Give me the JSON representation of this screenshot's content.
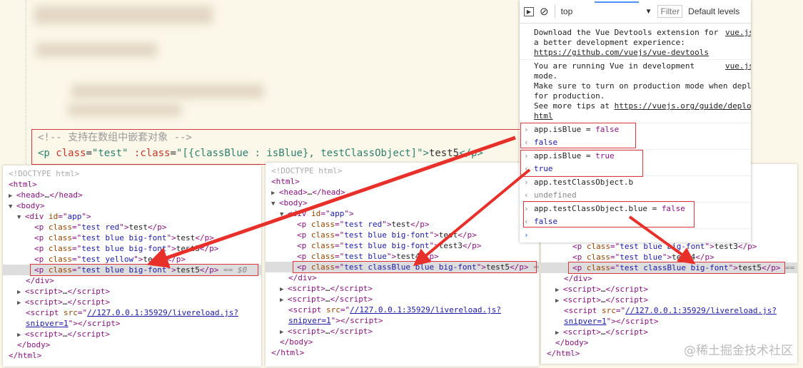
{
  "editor": {
    "comment": "<!-- 支持在数组中嵌套对象 -->",
    "line": [
      [
        "t",
        "<p "
      ],
      [
        "a",
        "class"
      ],
      [
        "x",
        "="
      ],
      [
        "v",
        "\"test\" "
      ],
      [
        "a",
        ":class"
      ],
      [
        "x",
        "="
      ],
      [
        "v",
        "\"[{classBlue : isBlue}, testClassObject]\""
      ],
      [
        "t",
        ">"
      ],
      [
        "x",
        "test5"
      ],
      [
        "t",
        "</p>"
      ]
    ]
  },
  "panels": [
    {
      "selected": 9,
      "lines": [
        [
          0,
          [
            [
              "cm",
              "<!DOCTYPE html>"
            ]
          ]
        ],
        [
          0,
          [
            [
              "tg",
              "<html>"
            ]
          ]
        ],
        [
          0,
          [
            [
              "ar",
              "▶ "
            ],
            [
              "tg",
              "<head>"
            ],
            [
              "tx",
              "…"
            ],
            [
              "tg",
              "</head>"
            ]
          ]
        ],
        [
          0,
          [
            [
              "ar",
              "▼ "
            ],
            [
              "tg",
              "<body>"
            ]
          ]
        ],
        [
          1,
          [
            [
              "ar",
              "▼ "
            ],
            [
              "tg",
              "<div "
            ],
            [
              "an",
              "id"
            ],
            [
              "tg",
              "=\""
            ],
            [
              "av",
              "app"
            ],
            [
              "tg",
              "\">"
            ]
          ]
        ],
        [
          3,
          [
            [
              "tg",
              "<p "
            ],
            [
              "an",
              "class"
            ],
            [
              "tg",
              "=\""
            ],
            [
              "av",
              "test red"
            ],
            [
              "tg",
              "\">"
            ],
            [
              "tx",
              "test"
            ],
            [
              "tg",
              "</p>"
            ]
          ]
        ],
        [
          3,
          [
            [
              "tg",
              "<p "
            ],
            [
              "an",
              "class"
            ],
            [
              "tg",
              "=\""
            ],
            [
              "av",
              "test blue big-font"
            ],
            [
              "tg",
              "\">"
            ],
            [
              "tx",
              "test"
            ],
            [
              "tg",
              "</p>"
            ]
          ]
        ],
        [
          3,
          [
            [
              "tg",
              "<p "
            ],
            [
              "an",
              "class"
            ],
            [
              "tg",
              "=\""
            ],
            [
              "av",
              "test blue big-font"
            ],
            [
              "tg",
              "\">"
            ],
            [
              "tx",
              "test3"
            ],
            [
              "tg",
              "</p>"
            ]
          ]
        ],
        [
          3,
          [
            [
              "tg",
              "<p "
            ],
            [
              "an",
              "class"
            ],
            [
              "tg",
              "=\""
            ],
            [
              "av",
              "test yellow"
            ],
            [
              "tg",
              "\">"
            ],
            [
              "tx",
              "test4"
            ],
            [
              "tg",
              "</p>"
            ]
          ]
        ],
        [
          3,
          [
            [
              "tg",
              "<p "
            ],
            [
              "an",
              "class"
            ],
            [
              "tg",
              "=\""
            ],
            [
              "av",
              "test blue big-font"
            ],
            [
              "tg",
              "\">"
            ],
            [
              "tx",
              "test5"
            ],
            [
              "tg",
              "</p>"
            ],
            [
              "dl",
              " == $0"
            ]
          ]
        ],
        [
          2,
          [
            [
              "tg",
              "</div>"
            ]
          ]
        ],
        [
          1,
          [
            [
              "ar",
              "▶ "
            ],
            [
              "tg",
              "<script>"
            ],
            [
              "tx",
              "…"
            ],
            [
              "tg",
              "</script>"
            ]
          ]
        ],
        [
          1,
          [
            [
              "ar",
              "▶ "
            ],
            [
              "tg",
              "<script>"
            ],
            [
              "tx",
              "…"
            ],
            [
              "tg",
              "</script>"
            ]
          ]
        ],
        [
          2,
          [
            [
              "tg",
              "<script "
            ],
            [
              "an",
              "src"
            ],
            [
              "tg",
              "=\""
            ],
            [
              "lk",
              "//127.0.0.1:35929/livereload.js?"
            ]
          ]
        ],
        [
          2,
          [
            [
              "lk",
              "snipver=1"
            ],
            [
              "tg",
              "\"></script>"
            ]
          ]
        ],
        [
          1,
          [
            [
              "ar",
              "▶ "
            ],
            [
              "tg",
              "<script>"
            ],
            [
              "tx",
              "…"
            ],
            [
              "tg",
              "</script>"
            ]
          ]
        ],
        [
          1,
          [
            [
              "tg",
              "</body>"
            ]
          ]
        ],
        [
          0,
          [
            [
              "tg",
              "</html>"
            ]
          ]
        ]
      ]
    },
    {
      "selected": 9,
      "lines": [
        [
          0,
          [
            [
              "cm",
              "<!DOCTYPE html>"
            ]
          ]
        ],
        [
          0,
          [
            [
              "tg",
              "<html>"
            ]
          ]
        ],
        [
          0,
          [
            [
              "ar",
              "▶ "
            ],
            [
              "tg",
              "<head>"
            ],
            [
              "tx",
              "…"
            ],
            [
              "tg",
              "</head>"
            ]
          ]
        ],
        [
          0,
          [
            [
              "ar",
              "▼ "
            ],
            [
              "tg",
              "<body>"
            ]
          ]
        ],
        [
          1,
          [
            [
              "ar",
              "▼ "
            ],
            [
              "tg",
              "<div "
            ],
            [
              "an",
              "id"
            ],
            [
              "tg",
              "=\""
            ],
            [
              "av",
              "app"
            ],
            [
              "tg",
              "\">"
            ]
          ]
        ],
        [
          3,
          [
            [
              "tg",
              "<p "
            ],
            [
              "an",
              "class"
            ],
            [
              "tg",
              "=\""
            ],
            [
              "av",
              "test red"
            ],
            [
              "tg",
              "\">"
            ],
            [
              "tx",
              "test"
            ],
            [
              "tg",
              "</p>"
            ]
          ]
        ],
        [
          3,
          [
            [
              "tg",
              "<p "
            ],
            [
              "an",
              "class"
            ],
            [
              "tg",
              "=\""
            ],
            [
              "av",
              "test blue big-font"
            ],
            [
              "tg",
              "\">"
            ],
            [
              "tx",
              "test"
            ],
            [
              "tg",
              "</p>"
            ]
          ]
        ],
        [
          3,
          [
            [
              "tg",
              "<p "
            ],
            [
              "an",
              "class"
            ],
            [
              "tg",
              "=\""
            ],
            [
              "av",
              "test blue big-font"
            ],
            [
              "tg",
              "\">"
            ],
            [
              "tx",
              "test3"
            ],
            [
              "tg",
              "</p>"
            ]
          ]
        ],
        [
          3,
          [
            [
              "tg",
              "<p "
            ],
            [
              "an",
              "class"
            ],
            [
              "tg",
              "=\""
            ],
            [
              "av",
              "test blue"
            ],
            [
              "tg",
              "\">"
            ],
            [
              "tx",
              "test4"
            ],
            [
              "tg",
              "</p>"
            ]
          ]
        ],
        [
          3,
          [
            [
              "tg",
              "<p "
            ],
            [
              "an",
              "class"
            ],
            [
              "tg",
              "=\""
            ],
            [
              "av",
              "test classBlue blue big-font"
            ],
            [
              "tg",
              "\">"
            ],
            [
              "tx",
              "test5"
            ],
            [
              "tg",
              "</p>"
            ],
            [
              "dl",
              " =="
            ]
          ]
        ],
        [
          2,
          [
            [
              "tg",
              "</div>"
            ]
          ]
        ],
        [
          1,
          [
            [
              "ar",
              "▶ "
            ],
            [
              "tg",
              "<script>"
            ],
            [
              "tx",
              "…"
            ],
            [
              "tg",
              "</script>"
            ]
          ]
        ],
        [
          1,
          [
            [
              "ar",
              "▶ "
            ],
            [
              "tg",
              "<script>"
            ],
            [
              "tx",
              "…"
            ],
            [
              "tg",
              "</script>"
            ]
          ]
        ],
        [
          2,
          [
            [
              "tg",
              "<script "
            ],
            [
              "an",
              "src"
            ],
            [
              "tg",
              "=\""
            ],
            [
              "lk",
              "//127.0.0.1:35929/livereload.js?"
            ]
          ]
        ],
        [
          2,
          [
            [
              "lk",
              "snipver=1"
            ],
            [
              "tg",
              "\"></script>"
            ]
          ]
        ],
        [
          1,
          [
            [
              "ar",
              "▶ "
            ],
            [
              "tg",
              "<script>"
            ],
            [
              "tx",
              "…"
            ],
            [
              "tg",
              "</script>"
            ]
          ]
        ],
        [
          1,
          [
            [
              "tg",
              "</body>"
            ]
          ]
        ],
        [
          0,
          [
            [
              "tg",
              "</html>"
            ]
          ]
        ]
      ]
    },
    {
      "selected": 2,
      "lines": [
        [
          3,
          [
            [
              "tg",
              "<p "
            ],
            [
              "an",
              "class"
            ],
            [
              "tg",
              "=\""
            ],
            [
              "av",
              "test blue big-font"
            ],
            [
              "tg",
              "\">"
            ],
            [
              "tx",
              "test3"
            ],
            [
              "tg",
              "</p>"
            ]
          ]
        ],
        [
          3,
          [
            [
              "tg",
              "<p "
            ],
            [
              "an",
              "class"
            ],
            [
              "tg",
              "=\""
            ],
            [
              "av",
              "test blue"
            ],
            [
              "tg",
              "\">"
            ],
            [
              "tx",
              "test4"
            ],
            [
              "tg",
              "</p>"
            ]
          ]
        ],
        [
          3,
          [
            [
              "tg",
              "<p "
            ],
            [
              "an",
              "class"
            ],
            [
              "tg",
              "=\""
            ],
            [
              "av",
              "test classBlue big-font"
            ],
            [
              "tg",
              "\">"
            ],
            [
              "tx",
              "test5"
            ],
            [
              "tg",
              "</p>"
            ],
            [
              "dl",
              " =="
            ]
          ]
        ],
        [
          2,
          [
            [
              "tg",
              "</div>"
            ]
          ]
        ],
        [
          1,
          [
            [
              "ar",
              "▶ "
            ],
            [
              "tg",
              "<script>"
            ],
            [
              "tx",
              "…"
            ],
            [
              "tg",
              "</script>"
            ]
          ]
        ],
        [
          1,
          [
            [
              "ar",
              "▶ "
            ],
            [
              "tg",
              "<script>"
            ],
            [
              "tx",
              "…"
            ],
            [
              "tg",
              "</script>"
            ]
          ]
        ],
        [
          2,
          [
            [
              "tg",
              "<script "
            ],
            [
              "an",
              "src"
            ],
            [
              "tg",
              "=\""
            ],
            [
              "lk",
              "//127.0.0.1:35929/livereload.js?"
            ]
          ]
        ],
        [
          2,
          [
            [
              "lk",
              "snipver=1"
            ],
            [
              "tg",
              "\"></script>"
            ]
          ]
        ],
        [
          1,
          [
            [
              "ar",
              "▶ "
            ],
            [
              "tg",
              "<script>"
            ],
            [
              "tx",
              "…"
            ],
            [
              "tg",
              "</script>"
            ]
          ]
        ],
        [
          1,
          [
            [
              "tg",
              "</body>"
            ]
          ]
        ],
        [
          0,
          [
            [
              "tg",
              "</html>"
            ]
          ]
        ]
      ]
    }
  ],
  "console": {
    "context": "top",
    "filter": "Filter",
    "levels": "Default levels",
    "msg1": {
      "text": "Download the Vue Devtools extension for\na better development experience:",
      "link": "https://github.com/vuejs/vue-devtools",
      "src": "vue.js"
    },
    "msg2": {
      "text": "You are running Vue in development\nmode.\nMake sure to turn on production mode when deploying\nfor production.\nSee more tips at ",
      "link": "https://vuejs.org/guide/deployment.\nhtml",
      "src": "vue.js"
    },
    "entries": [
      {
        "in": "app.isBlue = ",
        "kw": "false",
        "out": "false"
      },
      {
        "in": "app.isBlue = ",
        "kw": "true",
        "out": "true"
      },
      {
        "in": "app.testClassObject.b",
        "kw": "",
        "out": "undefined"
      },
      {
        "in": "app.testClassObject.blue = ",
        "kw": "false",
        "out": "false"
      }
    ]
  },
  "watermark": "@稀土掘金技术社区",
  "colors": {
    "highlight": "#d9363e",
    "arrow": "#e8302a"
  }
}
